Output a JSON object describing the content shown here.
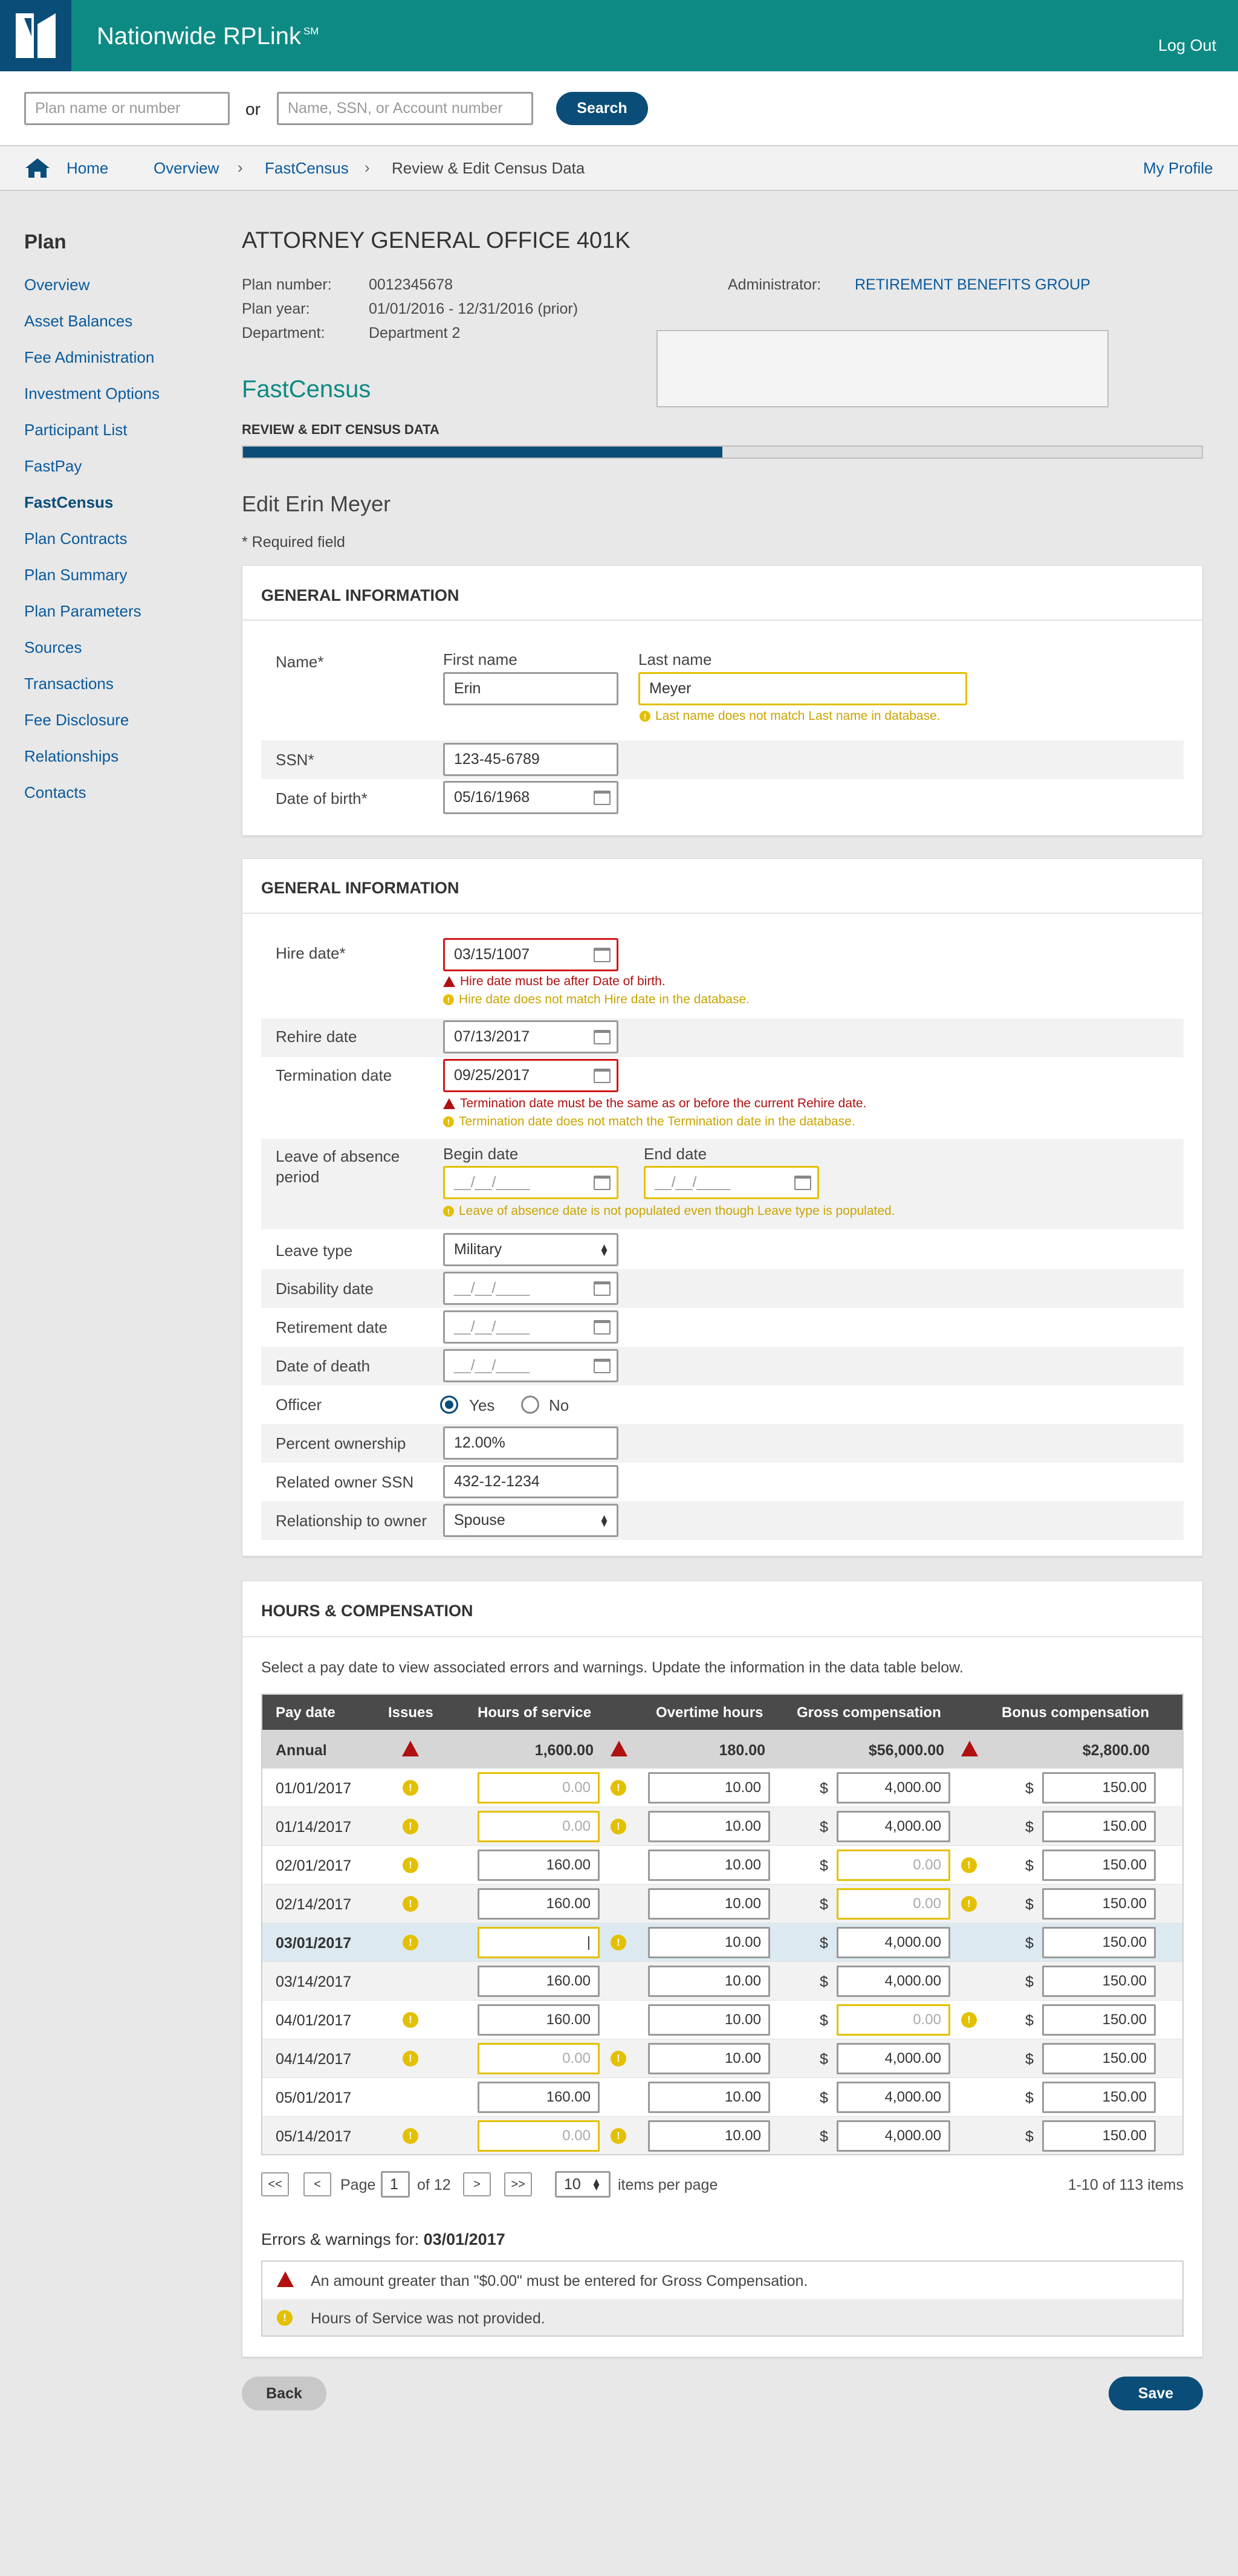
{
  "header": {
    "app_name": "Nationwide RPLink",
    "app_mark": "SM",
    "logout": "Log Out"
  },
  "search": {
    "plan_placeholder": "Plan name or number",
    "or": "or",
    "participant_placeholder": "Name, SSN, or Account number",
    "button": "Search"
  },
  "breadcrumb": {
    "items": [
      "Home",
      "Overview",
      "FastCensus",
      "Review & Edit Census Data"
    ],
    "my_profile": "My Profile"
  },
  "sidebar": {
    "title": "Plan",
    "active": "FastCensus",
    "items": [
      "Overview",
      "Asset Balances",
      "Fee Administration",
      "Investment Options",
      "Participant List",
      "FastPay",
      "FastCensus",
      "Plan Contracts",
      "Plan Summary",
      "Plan Parameters",
      "Sources",
      "Transactions",
      "Fee Disclosure",
      "Relationships",
      "Contacts"
    ]
  },
  "plan": {
    "title": "ATTORNEY GENERAL OFFICE 401K",
    "plan_number_label": "Plan number:",
    "plan_number": "0012345678",
    "plan_year_label": "Plan year:",
    "plan_year": "01/01/2016 - 12/31/2016 (prior)",
    "department_label": "Department:",
    "department": "Department 2",
    "administrator_label": "Administrator:",
    "administrator": "RETIREMENT BENEFITS GROUP"
  },
  "fastcensus": {
    "title": "FastCensus",
    "step": "REVIEW & EDIT CENSUS DATA",
    "progress": 0.5
  },
  "edit": {
    "title": "Edit Erin Meyer",
    "required_note": "* Required field"
  },
  "general1": {
    "heading": "GENERAL INFORMATION",
    "name_label": "Name*",
    "first_label": "First name",
    "first": "Erin",
    "last_label": "Last name",
    "last": "Meyer",
    "last_warning": "Last name does not match Last name in database.",
    "ssn_label": "SSN*",
    "ssn": "123-45-6789",
    "dob_label": "Date of birth*",
    "dob": "05/16/1968"
  },
  "general2": {
    "heading": "GENERAL INFORMATION",
    "hire_label": "Hire date*",
    "hire": "03/15/1007",
    "hire_error": "Hire date must be after Date of birth.",
    "hire_warning": "Hire date does not match Hire date in the database.",
    "rehire_label": "Rehire date",
    "rehire": "07/13/2017",
    "term_label": "Termination date",
    "term": "09/25/2017",
    "term_error": "Termination date must be the same as or before the current Rehire date.",
    "term_warning": "Termination date does not match the Termination date in the database.",
    "loa_label_1": "Leave of absence",
    "loa_label_2": "period",
    "begin_label": "Begin date",
    "end_label": "End date",
    "date_placeholder": "__/__/____",
    "loa_warning": "Leave of absence date is not populated even though Leave type is populated.",
    "leave_type_label": "Leave type",
    "leave_type": "Military",
    "disability_label": "Disability date",
    "retirement_label": "Retirement date",
    "death_label": "Date of death",
    "officer_label": "Officer",
    "yes": "Yes",
    "no": "No",
    "officer_value": "Yes",
    "pct_label": "Percent ownership",
    "pct": "12.00%",
    "rel_ssn_label": "Related owner SSN",
    "rel_ssn": "432-12-1234",
    "rel_owner_label": "Relationship to owner",
    "rel_owner": "Spouse"
  },
  "hours": {
    "heading": "HOURS & COMPENSATION",
    "instructions": "Select a pay date to view associated errors and warnings. Update the information in the data table below.",
    "columns": [
      "Pay date",
      "Issues",
      "Hours of service",
      "Overtime hours",
      "Gross compensation",
      "Bonus compensation"
    ],
    "currency": "$",
    "annual": {
      "label": "Annual",
      "hours": "1,600.00",
      "overtime": "180.00",
      "gross": "$56,000.00",
      "bonus": "$2,800.00"
    },
    "rows": [
      {
        "date": "01/01/2017",
        "issue": "warning",
        "hours": "0.00",
        "hours_warn": true,
        "overtime": "10.00",
        "gross": "4,000.00",
        "gross_warn": false,
        "bonus": "150.00"
      },
      {
        "date": "01/14/2017",
        "issue": "warning",
        "hours": "0.00",
        "hours_warn": true,
        "overtime": "10.00",
        "gross": "4,000.00",
        "gross_warn": false,
        "bonus": "150.00"
      },
      {
        "date": "02/01/2017",
        "issue": "warning",
        "hours": "160.00",
        "hours_warn": false,
        "overtime": "10.00",
        "gross": "0.00",
        "gross_warn": true,
        "bonus": "150.00"
      },
      {
        "date": "02/14/2017",
        "issue": "warning",
        "hours": "160.00",
        "hours_warn": false,
        "overtime": "10.00",
        "gross": "0.00",
        "gross_warn": true,
        "bonus": "150.00"
      },
      {
        "date": "03/01/2017",
        "issue": "warning",
        "hours": "",
        "hours_warn": true,
        "overtime": "10.00",
        "gross": "4,000.00",
        "gross_warn": false,
        "bonus": "150.00",
        "selected": true
      },
      {
        "date": "03/14/2017",
        "issue": "",
        "hours": "160.00",
        "hours_warn": false,
        "overtime": "10.00",
        "gross": "4,000.00",
        "gross_warn": false,
        "bonus": "150.00"
      },
      {
        "date": "04/01/2017",
        "issue": "warning",
        "hours": "160.00",
        "hours_warn": false,
        "overtime": "10.00",
        "gross": "0.00",
        "gross_warn": true,
        "bonus": "150.00"
      },
      {
        "date": "04/14/2017",
        "issue": "warning",
        "hours": "0.00",
        "hours_warn": true,
        "overtime": "10.00",
        "gross": "4,000.00",
        "gross_warn": false,
        "bonus": "150.00"
      },
      {
        "date": "05/01/2017",
        "issue": "",
        "hours": "160.00",
        "hours_warn": false,
        "overtime": "10.00",
        "gross": "4,000.00",
        "gross_warn": false,
        "bonus": "150.00"
      },
      {
        "date": "05/14/2017",
        "issue": "warning",
        "hours": "0.00",
        "hours_warn": true,
        "overtime": "10.00",
        "gross": "4,000.00",
        "gross_warn": false,
        "bonus": "150.00"
      }
    ],
    "pagination": {
      "first": "<<",
      "prev": "<",
      "page_label": "Page",
      "page": "1",
      "of": "of 12",
      "next": ">",
      "last": ">>",
      "per_page": "10",
      "per_page_label": "items per page",
      "range": "1-10 of  113 items"
    },
    "issues_title": "Errors & warnings for:",
    "issues_date": "03/01/2017",
    "issues": [
      {
        "type": "error",
        "text": "An amount greater than \"$0.00\" must be entered for Gross Compensation."
      },
      {
        "type": "warning",
        "text": "Hours of Service was not provided."
      }
    ]
  },
  "actions": {
    "back": "Back",
    "save": "Save"
  },
  "colors": {
    "teal": "#0d8a84",
    "navy": "#0a4d78",
    "link": "#0a5a9c",
    "error": "#b01010",
    "warning": "#e3c000"
  }
}
